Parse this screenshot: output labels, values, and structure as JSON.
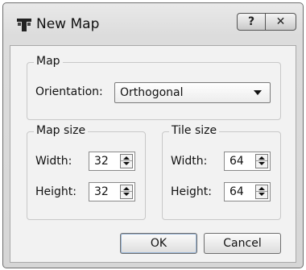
{
  "window": {
    "title": "New Map",
    "help_label": "?",
    "close_label": "✕"
  },
  "map_group": {
    "title": "Map",
    "orientation_label": "Orientation:",
    "orientation_value": "Orthogonal"
  },
  "map_size": {
    "title": "Map size",
    "width_label": "Width:",
    "width_value": "32",
    "height_label": "Height:",
    "height_value": "32"
  },
  "tile_size": {
    "title": "Tile size",
    "width_label": "Width:",
    "width_value": "64",
    "height_label": "Height:",
    "height_value": "64"
  },
  "buttons": {
    "ok": "OK",
    "cancel": "Cancel"
  }
}
